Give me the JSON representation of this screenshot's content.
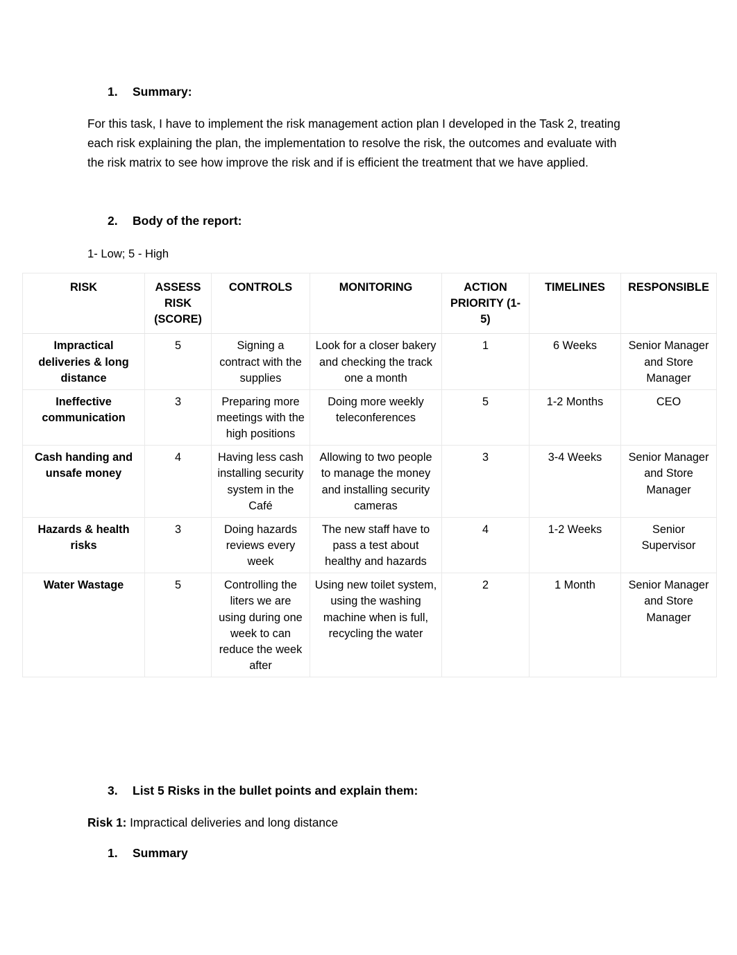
{
  "document": {
    "sections": [
      {
        "number": "1.",
        "title": "Summary:"
      },
      {
        "number": "2.",
        "title": "Body of the report:"
      },
      {
        "number": "3.",
        "title": "List 5 Risks in the bullet points and explain them:"
      }
    ],
    "summary_paragraph": "For this task, I have to implement the risk management action plan I developed in the Task 2, treating each risk explaining the plan, the implementation to resolve the risk, the outcomes and evaluate with the risk matrix to see how improve the risk and if is efficient the treatment that we have applied.",
    "scale_legend": "1- Low; 5 - High",
    "risk_1_label": "Risk 1:",
    "risk_1_text": " Impractical deliveries and long distance",
    "subsection": {
      "number": "1.",
      "title": "Summary"
    }
  },
  "table": {
    "headers": [
      "RISK",
      "ASSESS RISK (SCORE)",
      "CONTROLS",
      "MONITORING",
      "ACTION PRIORITY (1-5)",
      "TIMELINES",
      "RESPONSIBLE"
    ],
    "rows": [
      {
        "risk": "Impractical deliveries & long distance",
        "score": "5",
        "controls": "Signing a contract with the supplies",
        "monitoring": "Look for a closer bakery and checking the track one a month",
        "priority": "1",
        "timelines": "6 Weeks",
        "responsible": "Senior Manager and Store Manager"
      },
      {
        "risk": "Ineffective communication",
        "score": "3",
        "controls": "Preparing more meetings with the high positions",
        "monitoring": "Doing more weekly teleconferences",
        "priority": "5",
        "timelines": "1-2 Months",
        "responsible": "CEO"
      },
      {
        "risk": "Cash handing and unsafe money",
        "score": "4",
        "controls": "Having less cash installing security system in the Café",
        "monitoring": "Allowing to two people to manage the money and installing security cameras",
        "priority": "3",
        "timelines": "3-4 Weeks",
        "responsible": "Senior Manager and Store Manager"
      },
      {
        "risk": "Hazards & health risks",
        "score": "3",
        "controls": "Doing hazards reviews every week",
        "monitoring": "The new staff have to pass a test about healthy and hazards",
        "priority": "4",
        "timelines": "1-2 Weeks",
        "responsible": "Senior Supervisor"
      },
      {
        "risk": "Water Wastage",
        "score": "5",
        "controls": "Controlling the liters we are using during one week to can reduce the week after",
        "monitoring": "Using new toilet system, using the washing machine when is full, recycling the water",
        "priority": "2",
        "timelines": "1 Month",
        "responsible": "Senior Manager and Store Manager"
      }
    ]
  }
}
